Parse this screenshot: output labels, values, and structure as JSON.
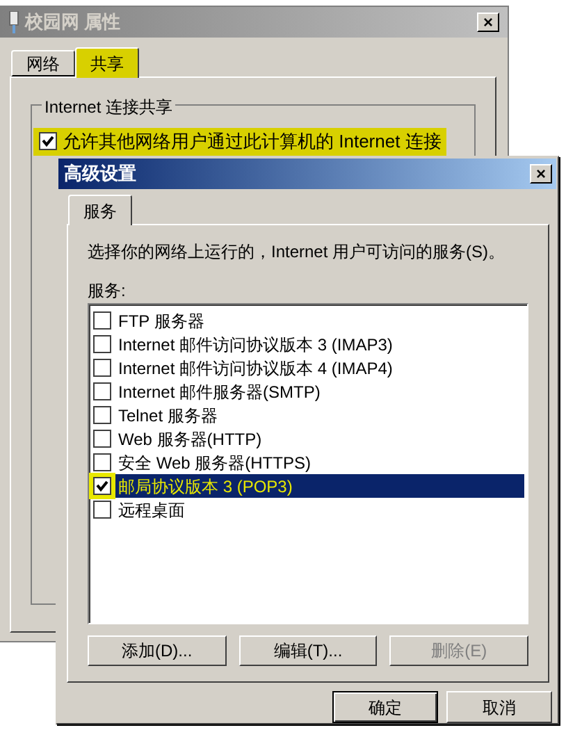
{
  "back_window": {
    "title": "校园网 属性",
    "close": "×",
    "tabs": [
      {
        "label": "网络",
        "selected": false,
        "highlighted": false
      },
      {
        "label": "共享",
        "selected": true,
        "highlighted": true
      }
    ],
    "group_title": "Internet 连接共享",
    "share_checkbox": {
      "label": "允许其他网络用户通过此计算机的 Internet 连接",
      "checked": true,
      "highlighted": true
    }
  },
  "dialog": {
    "title": "高级设置",
    "close": "×",
    "tabs": [
      {
        "label": "服务",
        "selected": true
      }
    ],
    "description": "选择你的网络上运行的，Internet 用户可访问的服务(S)。",
    "list_label": "服务:",
    "services": [
      {
        "label": "FTP 服务器",
        "checked": false,
        "selected": false,
        "highlighted": false
      },
      {
        "label": "Internet 邮件访问协议版本 3 (IMAP3)",
        "checked": false,
        "selected": false,
        "highlighted": false
      },
      {
        "label": "Internet 邮件访问协议版本 4 (IMAP4)",
        "checked": false,
        "selected": false,
        "highlighted": false
      },
      {
        "label": "Internet 邮件服务器(SMTP)",
        "checked": false,
        "selected": false,
        "highlighted": false
      },
      {
        "label": "Telnet 服务器",
        "checked": false,
        "selected": false,
        "highlighted": false
      },
      {
        "label": "Web 服务器(HTTP)",
        "checked": false,
        "selected": false,
        "highlighted": false
      },
      {
        "label": "安全 Web 服务器(HTTPS)",
        "checked": false,
        "selected": false,
        "highlighted": false
      },
      {
        "label": "邮局协议版本 3 (POP3)",
        "checked": true,
        "selected": true,
        "highlighted": true
      },
      {
        "label": "远程桌面",
        "checked": false,
        "selected": false,
        "highlighted": false
      }
    ],
    "list_buttons": [
      {
        "label": "添加(D)...",
        "disabled": false
      },
      {
        "label": "编辑(T)...",
        "disabled": false
      },
      {
        "label": "删除(E)",
        "disabled": true
      }
    ],
    "buttons": [
      {
        "label": "确定",
        "default": true
      },
      {
        "label": "取消",
        "default": false
      }
    ]
  }
}
